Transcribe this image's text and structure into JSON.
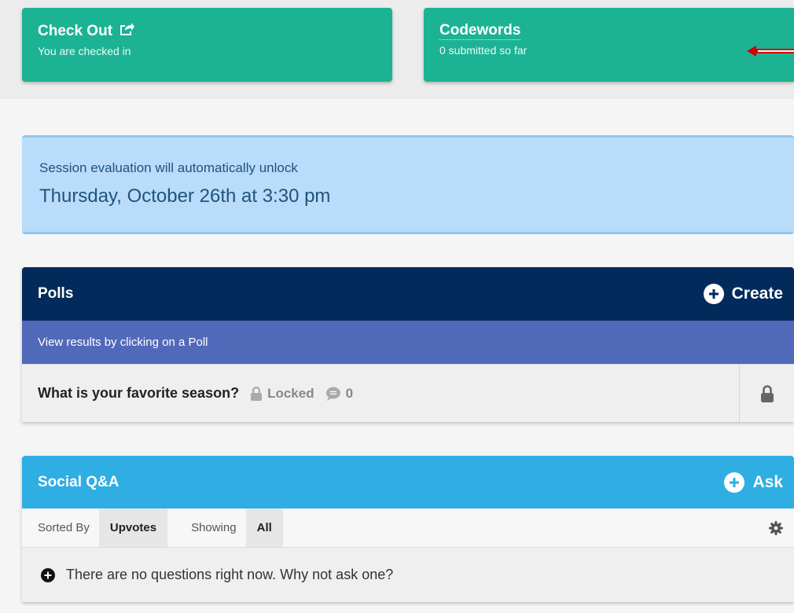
{
  "checkout": {
    "title": "Check Out",
    "subtitle": "You are checked in"
  },
  "codewords": {
    "title": "Codewords",
    "subtitle": "0 submitted so far"
  },
  "evaluation": {
    "line1": "Session evaluation will automatically unlock",
    "line2": "Thursday, October 26th at 3:30 pm"
  },
  "polls": {
    "title": "Polls",
    "create_label": "Create",
    "subtitle": "View results by clicking on a Poll",
    "items": [
      {
        "question": "What is your favorite season?",
        "status": "Locked",
        "comment_count": "0"
      }
    ]
  },
  "qa": {
    "title": "Social Q&A",
    "ask_label": "Ask",
    "sorted_by_label": "Sorted By",
    "sorted_by_value": "Upvotes",
    "showing_label": "Showing",
    "showing_value": "All",
    "empty_message": "There are no questions right now. Why not ask one?"
  },
  "colors": {
    "teal": "#1cb394",
    "navy": "#022b5b",
    "indigo": "#5169b9",
    "sky": "#2eaee3",
    "info_bg": "#b8dcfa",
    "arrow_red": "#d40000"
  },
  "icons": [
    "share-icon",
    "red-arrow-left-icon",
    "plus-circle-icon",
    "lock-icon",
    "comment-icon",
    "gear-icon"
  ]
}
